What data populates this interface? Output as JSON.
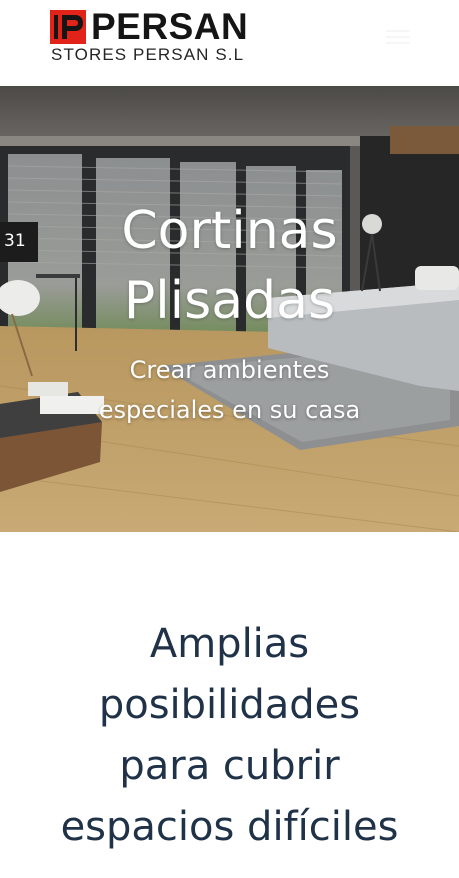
{
  "header": {
    "brand_name": "PERSAN",
    "brand_subtitle": "STORES PERSAN S.L",
    "logo_mark_letters": "IP",
    "menu_icon": "hamburger-menu-icon"
  },
  "hero": {
    "title": "Cortinas\nPlisadas",
    "subtitle": "Crear ambientes\nespeciales en su casa",
    "clock_text": "31"
  },
  "section": {
    "heading": "Amplias\nposibilidades\npara cubrir\nespacios difíciles"
  },
  "colors": {
    "brand_red": "#e1231a",
    "brand_dark": "#151515",
    "heading_navy": "#1f3248",
    "hero_text": "#ffffff"
  }
}
